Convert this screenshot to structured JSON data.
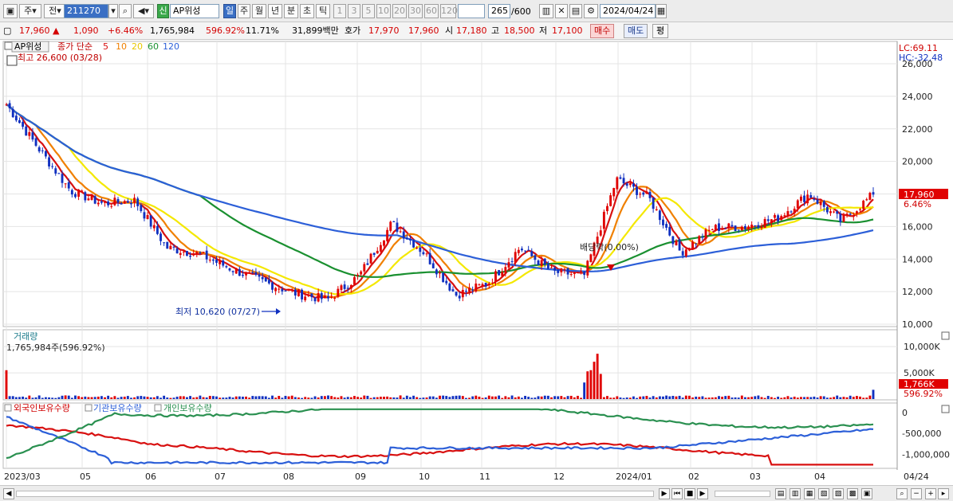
{
  "toolbar": {
    "market_label": "주",
    "type_label": "전",
    "code_value": "211270",
    "stock_badge": "신",
    "stock_name": "AP위성",
    "periods": [
      "일",
      "주",
      "월",
      "년",
      "분",
      "초",
      "틱"
    ],
    "intervals": [
      "1",
      "3",
      "5",
      "10",
      "20",
      "30",
      "60",
      "120"
    ],
    "count_value": "265",
    "count_total": "/600",
    "date_value": "2024/04/24"
  },
  "quote": {
    "price": "17,960",
    "change": "1,090",
    "change_pct": "+6.46%",
    "volume": "1,765,984",
    "volume_ratio": "596.92%",
    "turnover_pct": "11.71%",
    "amount": "31,899백만",
    "hoga_label": "호가",
    "hoga_ask": "17,970",
    "hoga_bid": "17,960",
    "open_label": "시",
    "open": "17,180",
    "high_label": "고",
    "high": "18,500",
    "low_label": "저",
    "low": "17,100",
    "buy_label": "매수",
    "sell_label": "매도",
    "eval_label": "평"
  },
  "colors": {
    "up": "#e00000",
    "down": "#1030c0",
    "ma5": "#d81010",
    "ma10": "#f08000",
    "ma20": "#f4e800",
    "ma60": "#1a9030",
    "ma120": "#2c5fd8",
    "foreign": "#d81010",
    "institution": "#2c5fd8",
    "individual": "#2a9050"
  },
  "price_panel": {
    "stock_label": "AP위성",
    "ma_title": "종가 단순",
    "ma_periods": [
      "5",
      "10",
      "20",
      "60",
      "120"
    ],
    "high_annotation": "최고 26,600 (03/28)",
    "low_annotation": "최저 10,620 (07/27)",
    "dividend_annotation": "배당락(0.00%)",
    "lc_label": "LC:69.11",
    "hc_label": "HC:-32.48",
    "current_price_tag": "17,960",
    "current_pct_tag": "6.46%",
    "y_ticks": [
      "26,000",
      "24,000",
      "22,000",
      "20,000",
      "18,000",
      "16,000",
      "14,000",
      "12,000",
      "10,000"
    ]
  },
  "volume_panel": {
    "title": "거래량",
    "readout": "1,765,984주(596.92%)",
    "y_ticks": [
      "10,000K",
      "5,000K"
    ],
    "tag_value": "1,766K",
    "tag_pct": "596.92%"
  },
  "holdings_panel": {
    "legend": [
      "외국인보유수량",
      "기관보유수량",
      "개인보유수량"
    ],
    "y_ticks": [
      "0",
      "-500,000",
      "-1,000,000"
    ]
  },
  "x_axis": {
    "labels": [
      "2023/03",
      "05",
      "06",
      "07",
      "08",
      "09",
      "10",
      "11",
      "12",
      "2024/01",
      "02",
      "03",
      "04"
    ],
    "right_label": "04/24"
  },
  "chart_data": {
    "type": "candlestick",
    "price_range": [
      10000,
      26600
    ],
    "ma_periods": [
      5,
      10,
      20,
      60,
      120
    ],
    "closes": [
      {
        "m": "2023/03",
        "v": 23500
      },
      {
        "m": "2023/04",
        "v": 20800
      },
      {
        "m": "2023/04b",
        "v": 18200
      },
      {
        "m": "2023/05",
        "v": 17400
      },
      {
        "m": "2023/05b",
        "v": 17600
      },
      {
        "m": "2023/06",
        "v": 14700
      },
      {
        "m": "2023/06b",
        "v": 14300
      },
      {
        "m": "2023/07",
        "v": 13400
      },
      {
        "m": "2023/07b",
        "v": 12600
      },
      {
        "m": "2023/08",
        "v": 11900
      },
      {
        "m": "2023/08b",
        "v": 11500
      },
      {
        "m": "2023/09",
        "v": 13000
      },
      {
        "m": "2023/09b",
        "v": 16200
      },
      {
        "m": "2023/10",
        "v": 14400
      },
      {
        "m": "2023/10b",
        "v": 11800
      },
      {
        "m": "2023/11",
        "v": 12500
      },
      {
        "m": "2023/11b",
        "v": 14700
      },
      {
        "m": "2023/12",
        "v": 13200
      },
      {
        "m": "2023/12b",
        "v": 13000
      },
      {
        "m": "2024/01",
        "v": 18900
      },
      {
        "m": "2024/01b",
        "v": 17800
      },
      {
        "m": "2024/02",
        "v": 14400
      },
      {
        "m": "2024/02b",
        "v": 15900
      },
      {
        "m": "2024/03",
        "v": 16000
      },
      {
        "m": "2024/03b",
        "v": 16500
      },
      {
        "m": "2024/04",
        "v": 18000
      },
      {
        "m": "2024/04b",
        "v": 16300
      },
      {
        "m": "2024/04/24",
        "v": 17960
      }
    ],
    "last_volume": 1765984,
    "volume_max_k": 12000
  }
}
